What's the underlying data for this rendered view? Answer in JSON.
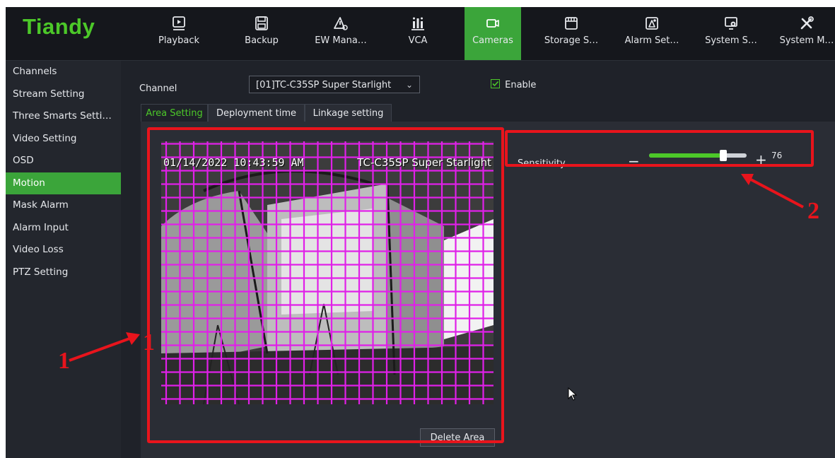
{
  "app": {
    "logo": "Tiandy"
  },
  "nav": [
    {
      "label": "Playback",
      "icon": "playback-icon",
      "active": false
    },
    {
      "label": "Backup",
      "icon": "save-icon",
      "active": false
    },
    {
      "label": "EW Mana…",
      "icon": "warning-icon",
      "active": false
    },
    {
      "label": "VCA",
      "icon": "vca-icon",
      "active": false
    },
    {
      "label": "Cameras",
      "icon": "camera-icon",
      "active": true
    },
    {
      "label": "Storage S…",
      "icon": "storage-icon",
      "active": false
    },
    {
      "label": "Alarm Set…",
      "icon": "alarm-icon",
      "active": false
    },
    {
      "label": "System S…",
      "icon": "system-settings-icon",
      "active": false
    },
    {
      "label": "System M…",
      "icon": "tools-icon",
      "active": false
    }
  ],
  "sidebar": {
    "items": [
      {
        "label": "Channels"
      },
      {
        "label": "Stream Setting"
      },
      {
        "label": "Three Smarts Setti…"
      },
      {
        "label": "Video Setting"
      },
      {
        "label": "OSD"
      },
      {
        "label": "Motion",
        "active": true
      },
      {
        "label": "Mask Alarm"
      },
      {
        "label": "Alarm Input"
      },
      {
        "label": "Video Loss"
      },
      {
        "label": "PTZ Setting"
      }
    ]
  },
  "main": {
    "channel_label": "Channel",
    "channel_value": "[01]TC-C35SP Super Starlight",
    "enable_label": "Enable",
    "enable_checked": true,
    "tabs": [
      {
        "label": "Area Setting",
        "active": true
      },
      {
        "label": "Deployment time"
      },
      {
        "label": "Linkage setting"
      }
    ],
    "video": {
      "osd_datetime": "01/14/2022 10:43:59 AM",
      "osd_name": "TC-C35SP Super Starlight"
    },
    "delete_area_label": "Delete Area",
    "sensitivity": {
      "label": "Sensitivity",
      "value": 76,
      "minus": "−",
      "plus": "+"
    }
  },
  "annotations": {
    "label_1": "1",
    "label_2": "2"
  },
  "colors": {
    "accent": "#3ba53a",
    "grid": "#e020e8",
    "annotation": "#e8141c"
  }
}
